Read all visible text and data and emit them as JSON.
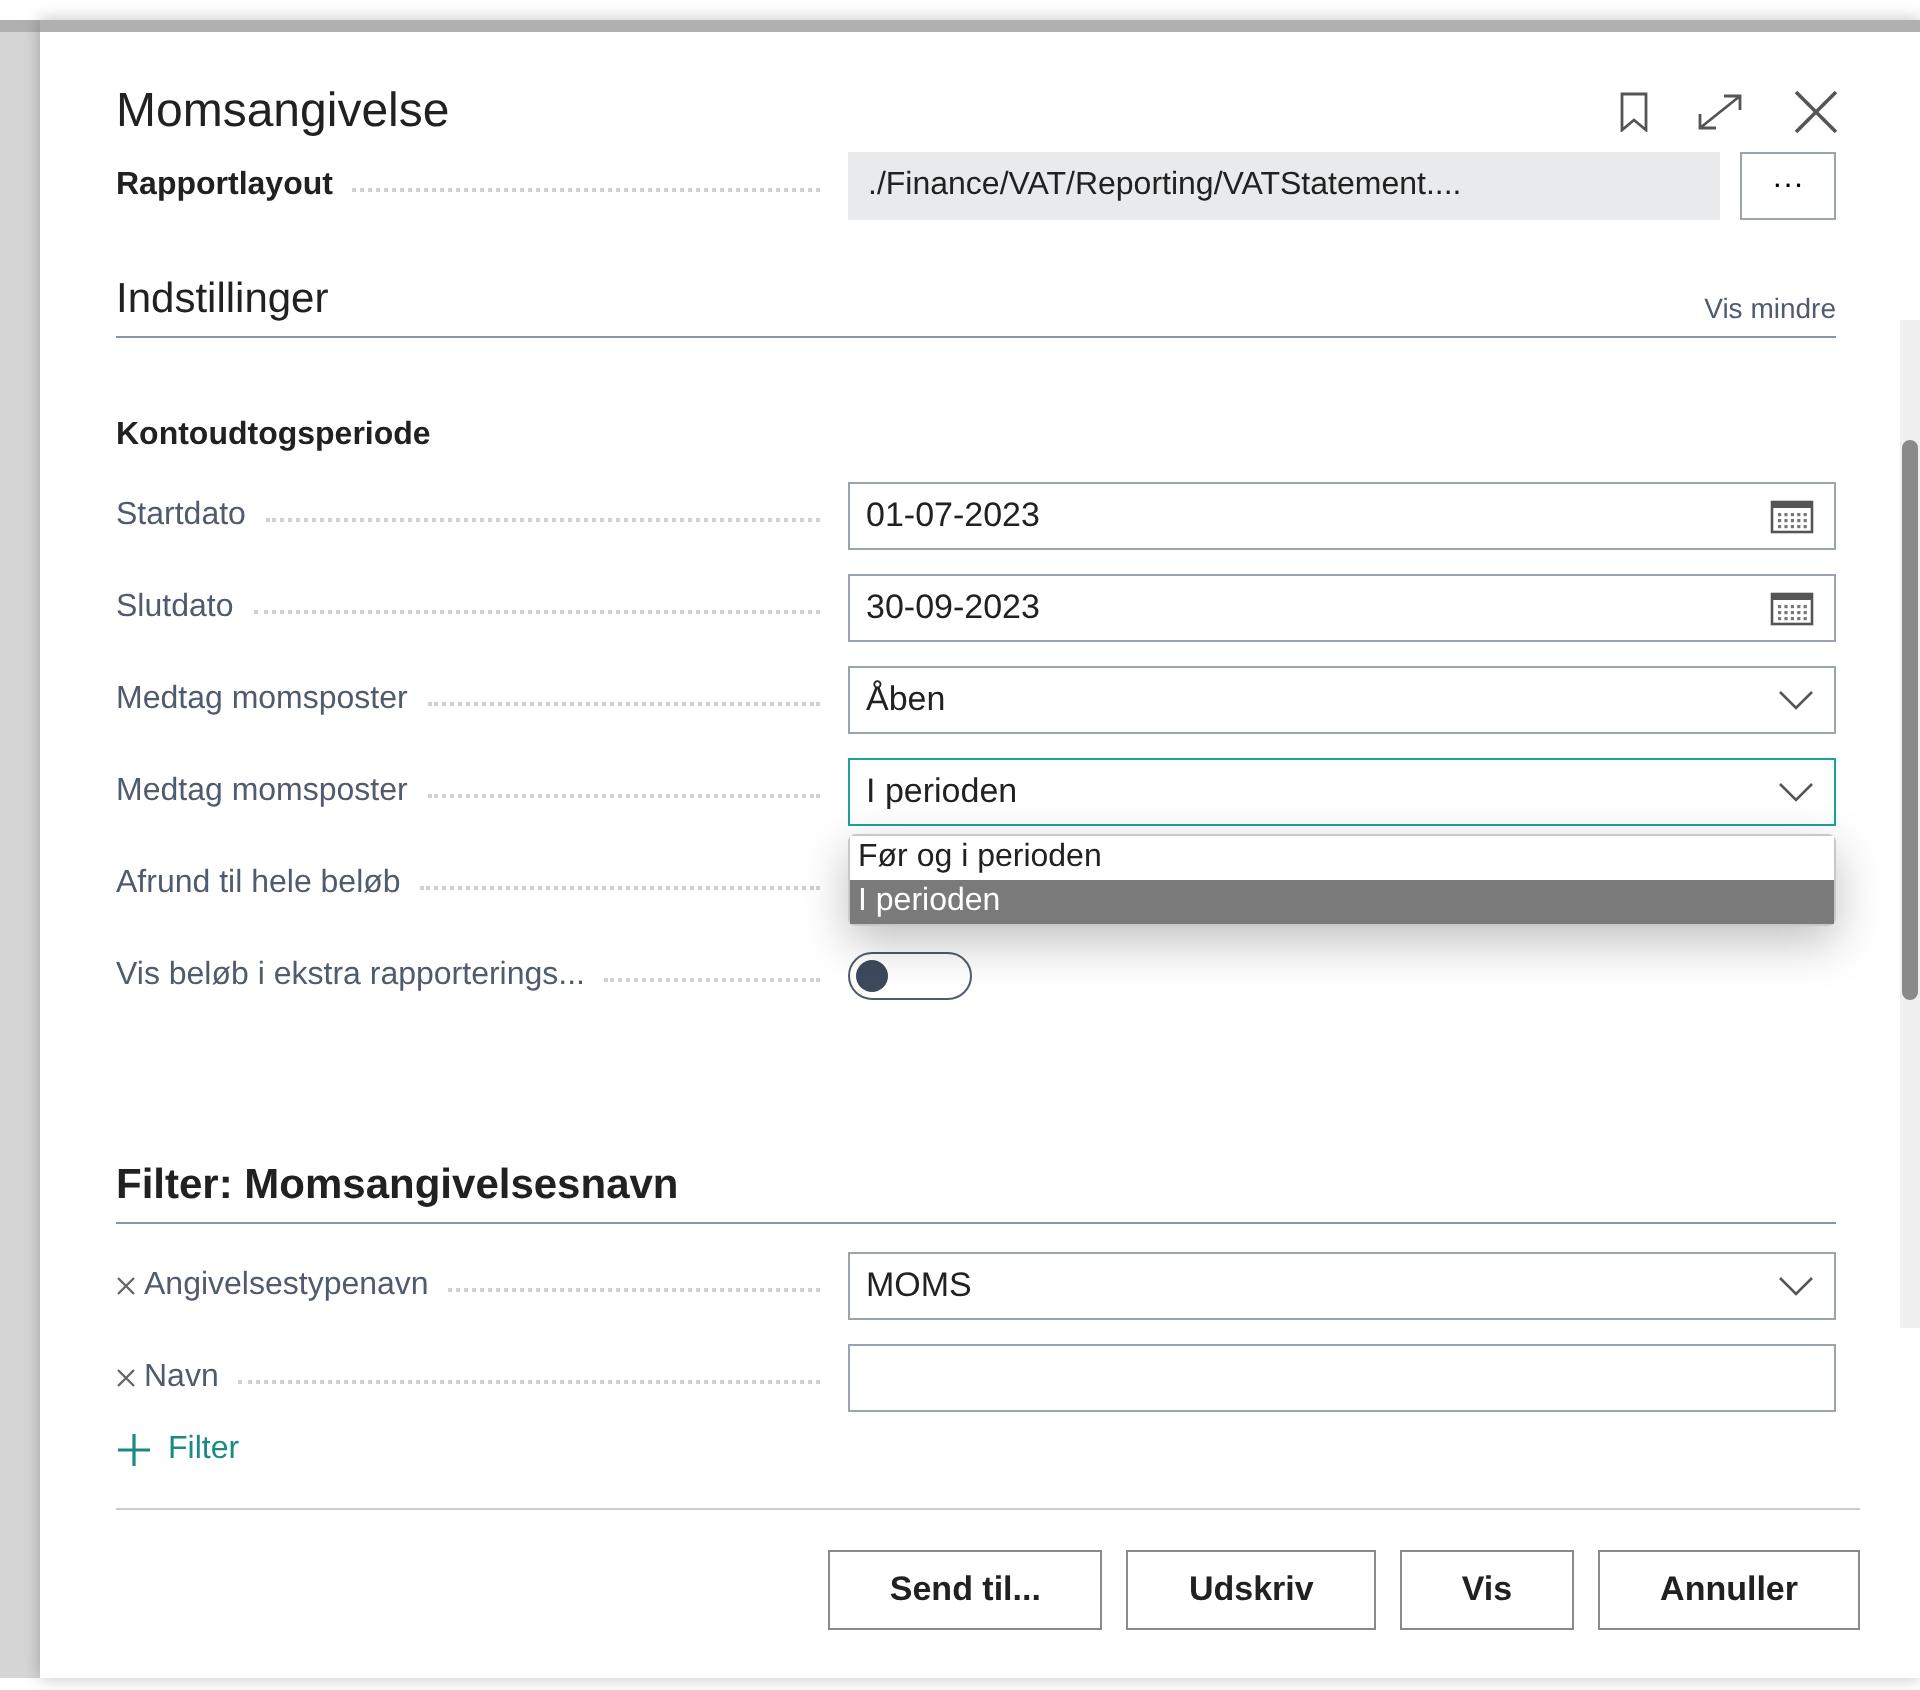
{
  "dialog": {
    "title": "Momsangivelse",
    "report_layout": {
      "label": "Rapportlayout",
      "value": "./Finance/VAT/Reporting/VATStatement....",
      "button": "···"
    },
    "settings": {
      "heading": "Indstillinger",
      "toggle_link": "Vis mindre",
      "group_label": "Kontoudtogsperiode",
      "fields": [
        {
          "kind": "date",
          "label": "Startdato",
          "value": "01-07-2023"
        },
        {
          "kind": "date",
          "label": "Slutdato",
          "value": "30-09-2023"
        },
        {
          "kind": "select",
          "label": "Medtag momsposter",
          "value": "Åben",
          "focused": false
        },
        {
          "kind": "select",
          "label": "Medtag momsposter",
          "value": "I perioden",
          "focused": true,
          "options": [
            {
              "label": "Før og i perioden",
              "selected": false
            },
            {
              "label": "I perioden",
              "selected": true
            }
          ]
        },
        {
          "kind": "covered",
          "label": "Afrund til hele beløb"
        },
        {
          "kind": "toggle",
          "label": "Vis beløb i ekstra rapporterings...",
          "on": false
        }
      ]
    },
    "filter": {
      "heading": "Filter: Momsangivelsesnavn",
      "fields": [
        {
          "kind": "select",
          "label": "Angivelsestypenavn",
          "value": "MOMS",
          "focused": false
        },
        {
          "kind": "text",
          "label": "Navn"
        }
      ],
      "add_filter": "Filter"
    },
    "buttons": [
      "Send til...",
      "Udskriv",
      "Vis",
      "Annuller"
    ]
  }
}
